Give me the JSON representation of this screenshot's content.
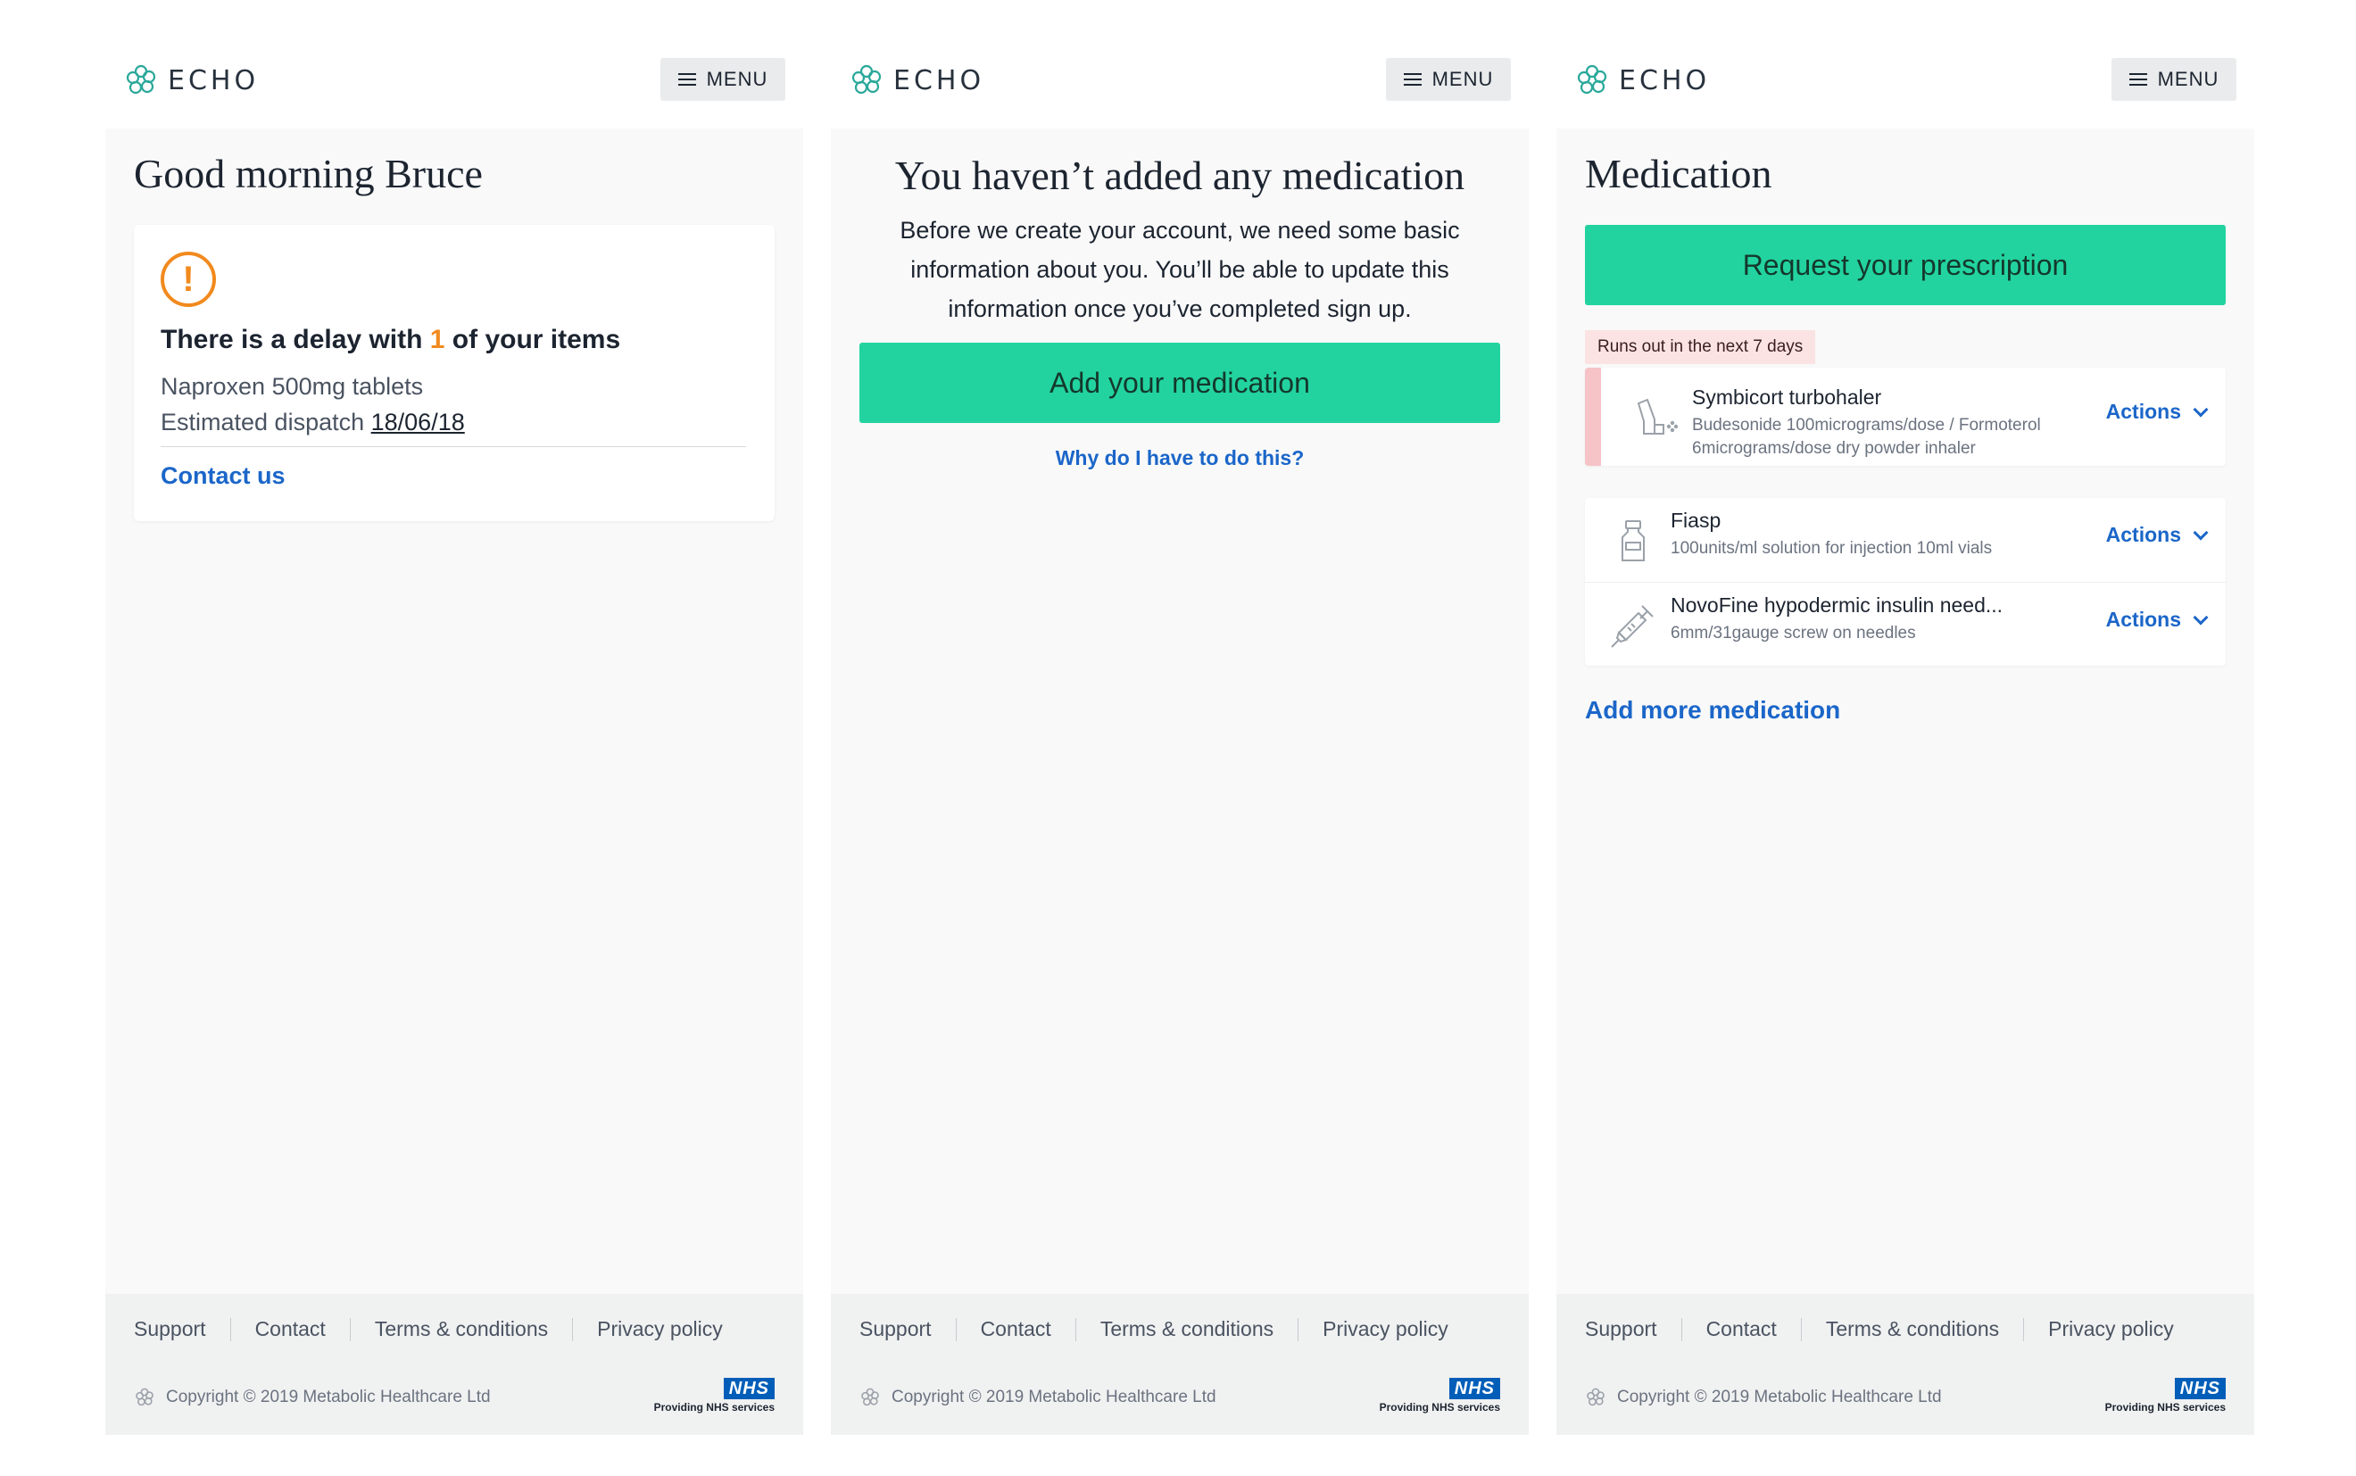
{
  "app": {
    "logo_text": "ECHO",
    "menu_label": "MENU"
  },
  "colors": {
    "brand_teal": "#2aa89a",
    "accent_green": "#22d39f",
    "link_blue": "#1b66c9",
    "warning_orange": "#f18a1e",
    "urgent_pink": "#f6c3c6"
  },
  "screen1": {
    "greeting": "Good morning Bruce",
    "alert": {
      "icon": "warning-circle-icon",
      "title_prefix": "There is a delay with ",
      "title_count": "1",
      "title_suffix": " of your items",
      "item": "Naproxen 500mg tablets",
      "dispatch_label": "Estimated dispatch ",
      "dispatch_date": "18/06/18",
      "contact_link": "Contact us"
    }
  },
  "screen2": {
    "title": "You haven’t added any medication",
    "intro": "Before we create your account, we need some basic information about you. You’ll be able to update this information once you’ve completed sign up.",
    "button": "Add your medication",
    "why_link": "Why do I have to do this?"
  },
  "screen3": {
    "title": "Medication",
    "request_button": "Request your prescription",
    "runs_out_badge": "Runs out in the next 7 days",
    "urgent_items": [
      {
        "name": "Symbicort turbohaler",
        "desc": "Budesonide 100micrograms/dose / Formoterol 6micrograms/dose dry powder inhaler",
        "icon": "inhaler-icon",
        "actions": "Actions"
      }
    ],
    "items": [
      {
        "name": "Fiasp",
        "desc": "100units/ml solution for injection 10ml vials",
        "icon": "vial-icon",
        "actions": "Actions"
      },
      {
        "name": "NovoFine hypodermic insulin need...",
        "desc": "6mm/31gauge screw on needles",
        "icon": "syringe-icon",
        "actions": "Actions"
      }
    ],
    "add_more": "Add more medication"
  },
  "footer": {
    "links": [
      "Support",
      "Contact",
      "Terms & conditions",
      "Privacy policy"
    ],
    "copyright": "Copyright © 2019 Metabolic Healthcare Ltd",
    "nhs_logo": "NHS",
    "nhs_text": "Providing NHS services"
  }
}
